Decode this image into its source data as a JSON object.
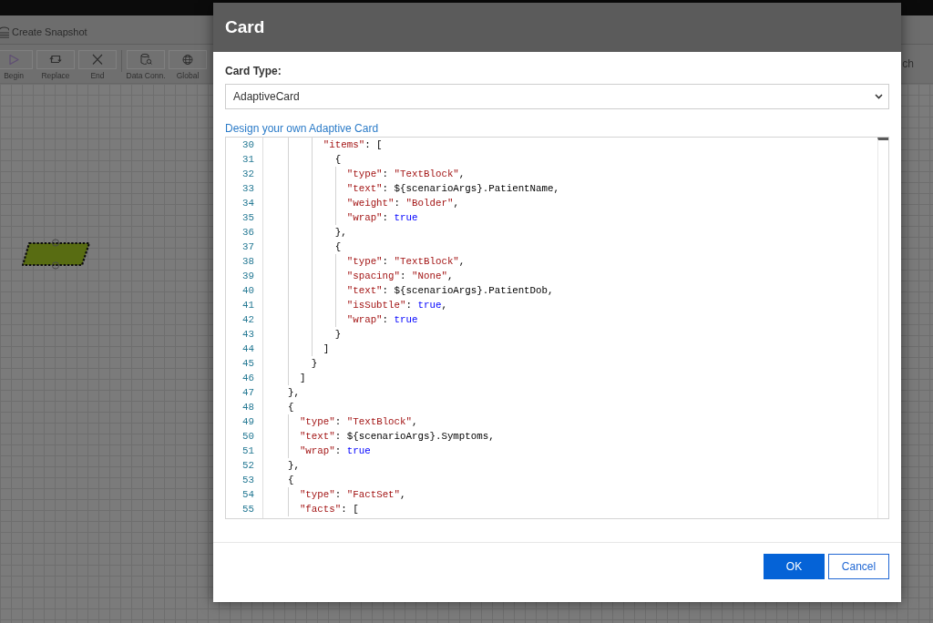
{
  "app": {
    "title_bar": {
      "command": "Create Snapshot"
    },
    "toolbar": {
      "groups": [
        {
          "items": [
            {
              "label": "Begin"
            },
            {
              "label": "Replace"
            },
            {
              "label": "End"
            }
          ]
        },
        {
          "items": [
            {
              "label": "Data Conn."
            },
            {
              "label": "Global"
            }
          ]
        }
      ],
      "partial_label": "ch"
    },
    "canvas": {
      "shapes": [
        {
          "kind": "parallelogram",
          "selected": true
        }
      ]
    }
  },
  "dialog": {
    "title": "Card",
    "card_type": {
      "label": "Card Type:",
      "value": "AdaptiveCard"
    },
    "link": "Design your own Adaptive Card",
    "editor": {
      "lines": [
        {
          "number": "30",
          "text": "          \"items\": ["
        },
        {
          "number": "31",
          "text": "            {"
        },
        {
          "number": "32",
          "text": "              \"type\": \"TextBlock\","
        },
        {
          "number": "33",
          "text": "              \"text\": ${scenarioArgs}.PatientName,"
        },
        {
          "number": "34",
          "text": "              \"weight\": \"Bolder\","
        },
        {
          "number": "35",
          "text": "              \"wrap\": true"
        },
        {
          "number": "36",
          "text": "            },"
        },
        {
          "number": "37",
          "text": "            {"
        },
        {
          "number": "38",
          "text": "              \"type\": \"TextBlock\","
        },
        {
          "number": "39",
          "text": "              \"spacing\": \"None\","
        },
        {
          "number": "40",
          "text": "              \"text\": ${scenarioArgs}.PatientDob,"
        },
        {
          "number": "41",
          "text": "              \"isSubtle\": true,"
        },
        {
          "number": "42",
          "text": "              \"wrap\": true"
        },
        {
          "number": "43",
          "text": "            }"
        },
        {
          "number": "44",
          "text": "          ]"
        },
        {
          "number": "45",
          "text": "        }"
        },
        {
          "number": "46",
          "text": "      ]"
        },
        {
          "number": "47",
          "text": "    },"
        },
        {
          "number": "48",
          "text": "    {"
        },
        {
          "number": "49",
          "text": "      \"type\": \"TextBlock\","
        },
        {
          "number": "50",
          "text": "      \"text\": ${scenarioArgs}.Symptoms,"
        },
        {
          "number": "51",
          "text": "      \"wrap\": true"
        },
        {
          "number": "52",
          "text": "    },"
        },
        {
          "number": "53",
          "text": "    {"
        },
        {
          "number": "54",
          "text": "      \"type\": \"FactSet\","
        },
        {
          "number": "55",
          "text": "      \"facts\": ["
        }
      ]
    },
    "buttons": [
      {
        "label": "OK",
        "kind": "primary"
      },
      {
        "label": "Cancel",
        "kind": "secondary"
      }
    ]
  }
}
